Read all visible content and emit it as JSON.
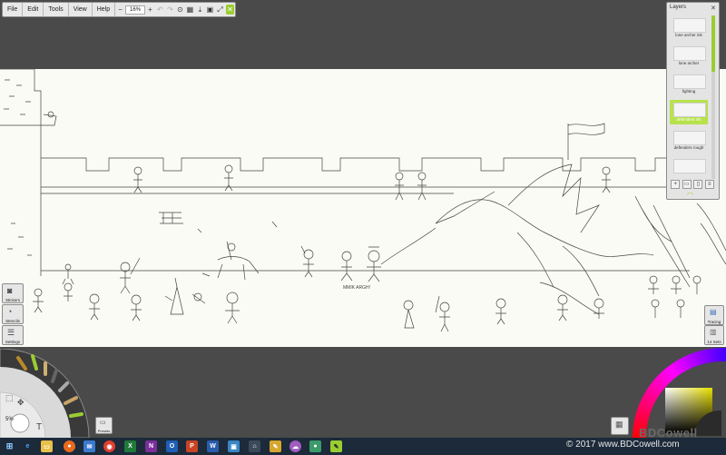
{
  "toolbar": {
    "menus": [
      "File",
      "Edit",
      "Tools",
      "View",
      "Help"
    ],
    "zoom": "16%"
  },
  "layers": {
    "title": "Layers",
    "items": [
      {
        "label": "lone archer ink",
        "selected": false
      },
      {
        "label": "lone archer",
        "selected": false
      },
      {
        "label": "fighting",
        "selected": false
      },
      {
        "label": "defenders ink",
        "selected": true
      },
      {
        "label": "defenders rough",
        "selected": false
      }
    ]
  },
  "left_buttons": {
    "stickers": "Stickers",
    "stencils": "Stencils",
    "settings": "Settings"
  },
  "right_buttons": {
    "tracing": "Tracing",
    "sets": "14 Sets"
  },
  "brush": {
    "size": "5%"
  },
  "presets_label": "Presets",
  "colors": {
    "accent": "#9acd32",
    "selected_layer": "#b7e24a",
    "canvas": "#fbfbf6"
  },
  "drawing_text": {
    "caption": "MMIK ARGH!"
  },
  "copyright": "© 2017 www.BDCowell.com",
  "taskbar_icons": [
    "windows-icon",
    "edge-icon",
    "search-icon",
    "file-explorer-icon",
    "firefox-icon",
    "chrome-icon",
    "excel-icon",
    "onenote-icon",
    "outlook-icon",
    "powerpoint-icon",
    "word-icon",
    "remote-desktop-icon",
    "ink-icon",
    "pencil-icon",
    "cloud-icon",
    "pinned-app-icon",
    "sketchbook-icon"
  ]
}
